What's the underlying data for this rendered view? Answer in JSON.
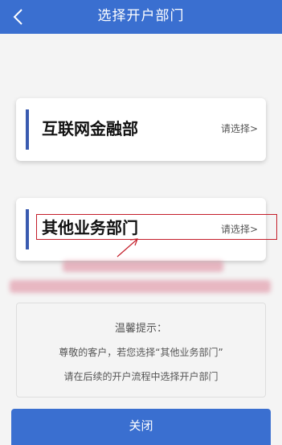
{
  "header": {
    "title": "选择开户部门"
  },
  "departments": [
    {
      "name": "互联网金融部",
      "hint": "请选择>"
    },
    {
      "name": "其他业务部门",
      "hint": "请选择>"
    }
  ],
  "tip": {
    "title": "温馨提示：",
    "line1": "尊敬的客户，若您选择“其他业务部门”",
    "line2": "请在后续的开户流程中选择开户部门"
  },
  "footer": {
    "close_label": "关闭"
  },
  "colors": {
    "primary": "#3a6fd0",
    "accent_bar": "#3a5bb0",
    "highlight": "#c41e2a"
  }
}
